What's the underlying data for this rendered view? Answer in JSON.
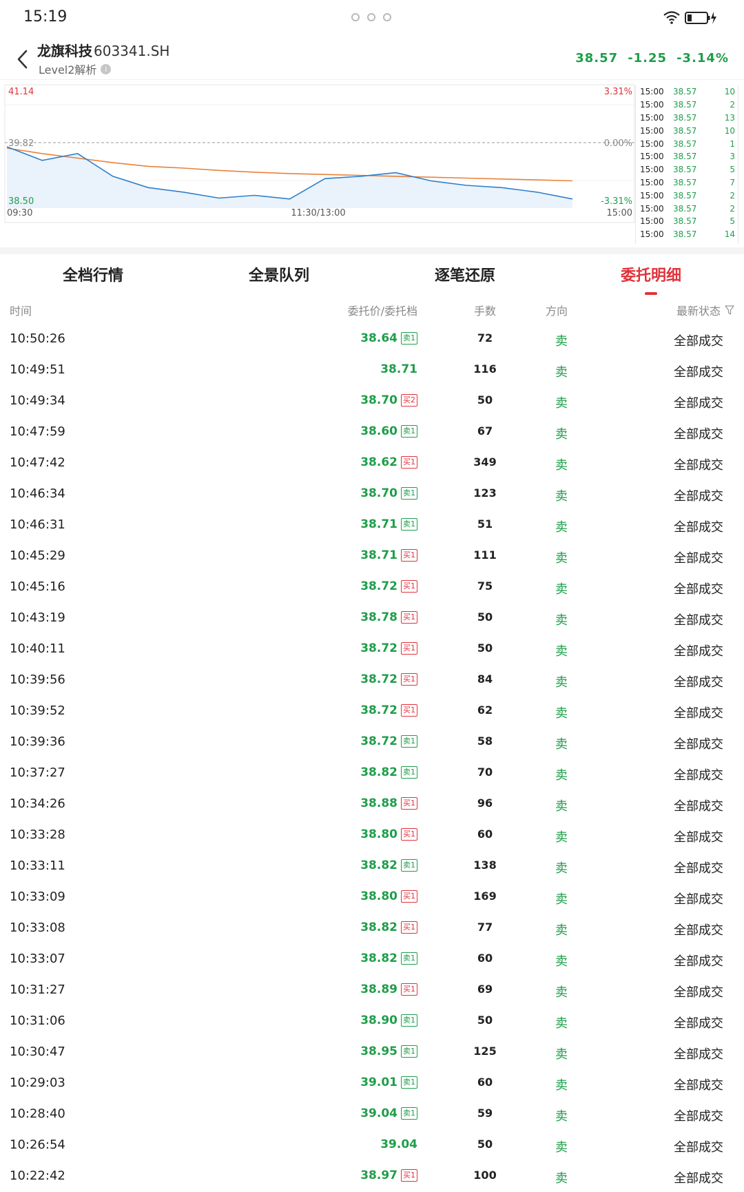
{
  "status_bar": {
    "time": "15:19"
  },
  "header": {
    "stock_name": "龙旗科技",
    "stock_code": "603341.SH",
    "subtitle": "Level2解析",
    "price": "38.57",
    "change": "-1.25",
    "change_pct": "-3.14%"
  },
  "chart": {
    "high_label": "41.14",
    "mid_label": "39.82",
    "low_label": "38.50",
    "pct_high": "3.31%",
    "pct_mid": "0.00%",
    "pct_low": "-3.31%",
    "time_start": "09:30",
    "time_mid": "11:30/13:00",
    "time_end": "15:00",
    "colors": {
      "price_line": "#2f7fc9",
      "avg_line": "#e8823a",
      "fill": "#eaf2fb",
      "up": "#e0323b",
      "down": "#1e9e4a"
    }
  },
  "chart_data": {
    "type": "line",
    "title": "",
    "xlabel": "",
    "ylabel": "",
    "ylim": [
      38.5,
      41.14
    ],
    "x": [
      "09:30",
      "09:45",
      "10:00",
      "10:15",
      "10:30",
      "10:45",
      "11:00",
      "11:15",
      "11:30",
      "13:15",
      "13:30",
      "13:45",
      "14:00",
      "14:15",
      "14:30",
      "14:45",
      "15:00"
    ],
    "series": [
      {
        "values": [
          39.85,
          39.55,
          39.7,
          39.2,
          38.95,
          38.85,
          38.72,
          38.78,
          38.7,
          39.15,
          39.2,
          39.28,
          39.1,
          39.0,
          38.95,
          38.85,
          38.7
        ]
      },
      {
        "values": [
          39.82,
          39.7,
          39.6,
          39.5,
          39.42,
          39.38,
          39.33,
          39.29,
          39.26,
          39.24,
          39.22,
          39.2,
          39.18,
          39.16,
          39.14,
          39.12,
          39.1
        ]
      }
    ]
  },
  "ticks": [
    {
      "time": "15:00",
      "price": "38.57",
      "vol": "10"
    },
    {
      "time": "15:00",
      "price": "38.57",
      "vol": "2"
    },
    {
      "time": "15:00",
      "price": "38.57",
      "vol": "13"
    },
    {
      "time": "15:00",
      "price": "38.57",
      "vol": "10"
    },
    {
      "time": "15:00",
      "price": "38.57",
      "vol": "1"
    },
    {
      "time": "15:00",
      "price": "38.57",
      "vol": "3"
    },
    {
      "time": "15:00",
      "price": "38.57",
      "vol": "5"
    },
    {
      "time": "15:00",
      "price": "38.57",
      "vol": "7"
    },
    {
      "time": "15:00",
      "price": "38.57",
      "vol": "2"
    },
    {
      "time": "15:00",
      "price": "38.57",
      "vol": "2"
    },
    {
      "time": "15:00",
      "price": "38.57",
      "vol": "5"
    },
    {
      "time": "15:00",
      "price": "38.57",
      "vol": "14"
    }
  ],
  "tabs": [
    {
      "label": "全档行情",
      "active": false
    },
    {
      "label": "全景队列",
      "active": false
    },
    {
      "label": "逐笔还原",
      "active": false
    },
    {
      "label": "委托明细",
      "active": true
    }
  ],
  "table": {
    "headers": {
      "time": "时间",
      "price": "委托价/委托档",
      "qty": "手数",
      "dir": "方向",
      "status": "最新状态"
    },
    "rows": [
      {
        "time": "10:50:26",
        "price": "38.64",
        "badge": "卖1",
        "badge_type": "sell",
        "qty": "72",
        "dir": "卖",
        "status": "全部成交"
      },
      {
        "time": "10:49:51",
        "price": "38.71",
        "badge": "",
        "badge_type": "",
        "qty": "116",
        "dir": "卖",
        "status": "全部成交"
      },
      {
        "time": "10:49:34",
        "price": "38.70",
        "badge": "买2",
        "badge_type": "buy",
        "qty": "50",
        "dir": "卖",
        "status": "全部成交"
      },
      {
        "time": "10:47:59",
        "price": "38.60",
        "badge": "卖1",
        "badge_type": "sell",
        "qty": "67",
        "dir": "卖",
        "status": "全部成交"
      },
      {
        "time": "10:47:42",
        "price": "38.62",
        "badge": "买1",
        "badge_type": "buy",
        "qty": "349",
        "dir": "卖",
        "status": "全部成交"
      },
      {
        "time": "10:46:34",
        "price": "38.70",
        "badge": "卖1",
        "badge_type": "sell",
        "qty": "123",
        "dir": "卖",
        "status": "全部成交"
      },
      {
        "time": "10:46:31",
        "price": "38.71",
        "badge": "卖1",
        "badge_type": "sell",
        "qty": "51",
        "dir": "卖",
        "status": "全部成交"
      },
      {
        "time": "10:45:29",
        "price": "38.71",
        "badge": "买1",
        "badge_type": "buy",
        "qty": "111",
        "dir": "卖",
        "status": "全部成交"
      },
      {
        "time": "10:45:16",
        "price": "38.72",
        "badge": "买1",
        "badge_type": "buy",
        "qty": "75",
        "dir": "卖",
        "status": "全部成交"
      },
      {
        "time": "10:43:19",
        "price": "38.78",
        "badge": "买1",
        "badge_type": "buy",
        "qty": "50",
        "dir": "卖",
        "status": "全部成交"
      },
      {
        "time": "10:40:11",
        "price": "38.72",
        "badge": "买1",
        "badge_type": "buy",
        "qty": "50",
        "dir": "卖",
        "status": "全部成交"
      },
      {
        "time": "10:39:56",
        "price": "38.72",
        "badge": "买1",
        "badge_type": "buy",
        "qty": "84",
        "dir": "卖",
        "status": "全部成交"
      },
      {
        "time": "10:39:52",
        "price": "38.72",
        "badge": "买1",
        "badge_type": "buy",
        "qty": "62",
        "dir": "卖",
        "status": "全部成交"
      },
      {
        "time": "10:39:36",
        "price": "38.72",
        "badge": "卖1",
        "badge_type": "sell",
        "qty": "58",
        "dir": "卖",
        "status": "全部成交"
      },
      {
        "time": "10:37:27",
        "price": "38.82",
        "badge": "卖1",
        "badge_type": "sell",
        "qty": "70",
        "dir": "卖",
        "status": "全部成交"
      },
      {
        "time": "10:34:26",
        "price": "38.88",
        "badge": "买1",
        "badge_type": "buy",
        "qty": "96",
        "dir": "卖",
        "status": "全部成交"
      },
      {
        "time": "10:33:28",
        "price": "38.80",
        "badge": "买1",
        "badge_type": "buy",
        "qty": "60",
        "dir": "卖",
        "status": "全部成交"
      },
      {
        "time": "10:33:11",
        "price": "38.82",
        "badge": "卖1",
        "badge_type": "sell",
        "qty": "138",
        "dir": "卖",
        "status": "全部成交"
      },
      {
        "time": "10:33:09",
        "price": "38.80",
        "badge": "买1",
        "badge_type": "buy",
        "qty": "169",
        "dir": "卖",
        "status": "全部成交"
      },
      {
        "time": "10:33:08",
        "price": "38.82",
        "badge": "买1",
        "badge_type": "buy",
        "qty": "77",
        "dir": "卖",
        "status": "全部成交"
      },
      {
        "time": "10:33:07",
        "price": "38.82",
        "badge": "卖1",
        "badge_type": "sell",
        "qty": "60",
        "dir": "卖",
        "status": "全部成交"
      },
      {
        "time": "10:31:27",
        "price": "38.89",
        "badge": "买1",
        "badge_type": "buy",
        "qty": "69",
        "dir": "卖",
        "status": "全部成交"
      },
      {
        "time": "10:31:06",
        "price": "38.90",
        "badge": "卖1",
        "badge_type": "sell",
        "qty": "50",
        "dir": "卖",
        "status": "全部成交"
      },
      {
        "time": "10:30:47",
        "price": "38.95",
        "badge": "卖1",
        "badge_type": "sell",
        "qty": "125",
        "dir": "卖",
        "status": "全部成交"
      },
      {
        "time": "10:29:03",
        "price": "39.01",
        "badge": "卖1",
        "badge_type": "sell",
        "qty": "60",
        "dir": "卖",
        "status": "全部成交"
      },
      {
        "time": "10:28:40",
        "price": "39.04",
        "badge": "卖1",
        "badge_type": "sell",
        "qty": "59",
        "dir": "卖",
        "status": "全部成交"
      },
      {
        "time": "10:26:54",
        "price": "39.04",
        "badge": "",
        "badge_type": "",
        "qty": "50",
        "dir": "卖",
        "status": "全部成交"
      },
      {
        "time": "10:22:42",
        "price": "38.97",
        "badge": "买1",
        "badge_type": "buy",
        "qty": "100",
        "dir": "卖",
        "status": "全部成交"
      }
    ]
  }
}
